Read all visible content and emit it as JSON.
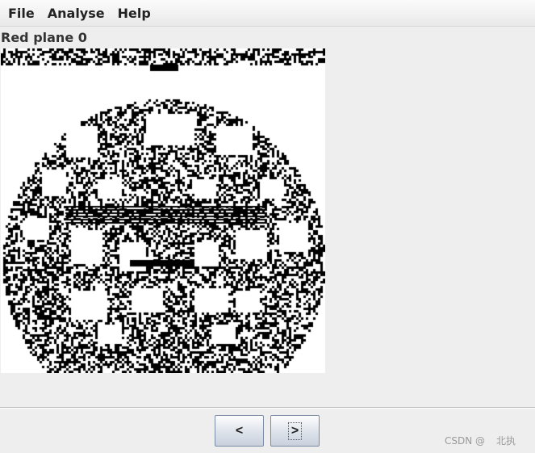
{
  "menubar": {
    "items": [
      "File",
      "Analyse",
      "Help"
    ]
  },
  "panel": {
    "title": "Red plane 0"
  },
  "image": {
    "description_icon": "bit-plane-image",
    "colors": {
      "on": "#000000",
      "off": "#ffffff"
    }
  },
  "nav": {
    "prev_label": "<",
    "next_label": ">"
  },
  "watermark": {
    "site": "CSDN @",
    "author": "北执"
  }
}
